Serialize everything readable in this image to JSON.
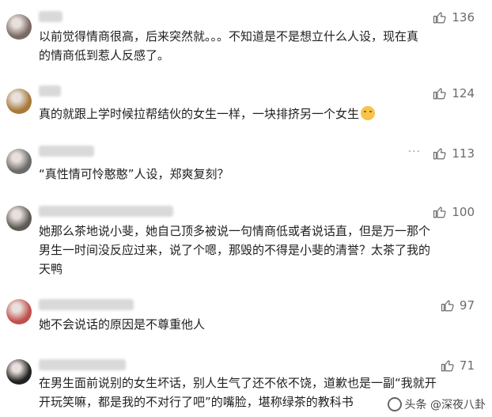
{
  "comments": [
    {
      "text": "以前觉得情商很高，后来突然就。。。不知道是不是想立什么人设，现在真\n的情商低到惹人反感了。",
      "likes": "136",
      "avatar_color": "#7a6a66"
    },
    {
      "text": "真的就跟上学时候拉帮结伙的女生一样，一块排挤另一个女生",
      "likes": "124",
      "avatar_color": "#a77a3a",
      "has_emoji": true
    },
    {
      "text": "“真性情可怜憨憨”人设，郑爽复刻？",
      "likes": "113",
      "avatar_color": "#6b6b6b",
      "more": "···"
    },
    {
      "text": "她那么茶地说小斐，她自己顶多被说一句情商低或者说话直，但是万一那个\n男生一时间没反应过来，说了个嗯，那毁的不得是小斐的清誉？太茶了我的\n天鸭",
      "likes": "100",
      "avatar_color": "#5e5a54"
    },
    {
      "text": "她不会说话的原因是不尊重他人",
      "likes": "97",
      "avatar_color": "#c0504d"
    },
    {
      "text": "在男生面前说别的女生坏话，别人生气了还不依不饶，道歉也是一副“我就开\n开玩笑嘛，都是我的不对行了吧”的嘴脸，堪称绿茶的教科书",
      "likes": "71",
      "avatar_color": "#222222"
    }
  ],
  "watermark": "头条 @深夜八卦"
}
